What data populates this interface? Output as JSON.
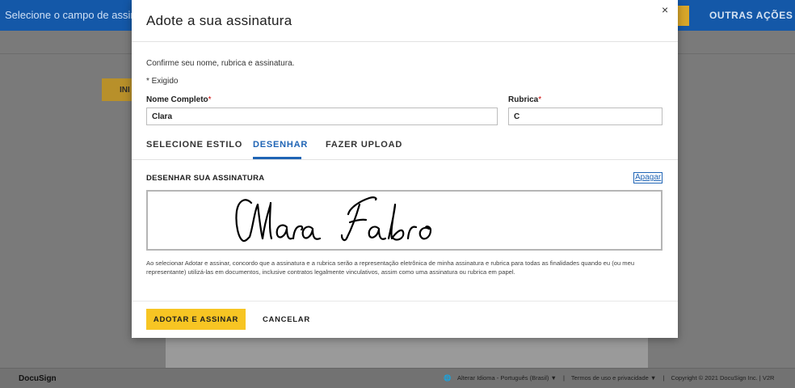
{
  "app": {
    "hint_text": "Selecione o campo de assinatura",
    "other_actions_label": "OUTRAS AÇÕES ▾",
    "ini_label": "INI"
  },
  "modal": {
    "title": "Adote a sua assinatura",
    "close_glyph": "×",
    "intro": "Confirme seu nome, rubrica e assinatura.",
    "required_note": "* Exigido",
    "full_name": {
      "label": "Nome Completo",
      "required_mark": "*",
      "value": "Clara"
    },
    "initials": {
      "label": "Rubrica",
      "required_mark": "*",
      "value": "C"
    },
    "tabs": [
      {
        "label": "SELECIONE ESTILO",
        "active": false
      },
      {
        "label": "DESENHAR",
        "active": true
      },
      {
        "label": "FAZER UPLOAD",
        "active": false
      }
    ],
    "draw_section_label": "DESENHAR SUA ASSINATURA",
    "erase_link": "Apagar",
    "legal_text": "Ao selecionar Adotar e assinar, concordo que a assinatura e a rubrica serão a representação eletrônica de minha assinatura e rubrica para todas as finalidades quando eu (ou meu representante) utilizá-las em documentos, inclusive contratos legalmente vinculativos, assim como uma assinatura ou rubrica em papel.",
    "adopt_button": "ADOTAR E ASSINAR",
    "cancel_button": "CANCELAR"
  },
  "footer": {
    "brand": "DocuSign",
    "language": "Alterar Idioma - Português (Brasil) ▼",
    "terms": "Termos de uso e privacidade ▼",
    "copyright": "Copyright © 2021 DocuSign Inc. | V2R"
  },
  "colors": {
    "topbar": "#1458a8",
    "accent_blue": "#1f64b5",
    "primary_button": "#f7c523",
    "required_star": "#cc0000"
  },
  "icons": {
    "close": "close-icon",
    "globe": "globe-icon"
  }
}
